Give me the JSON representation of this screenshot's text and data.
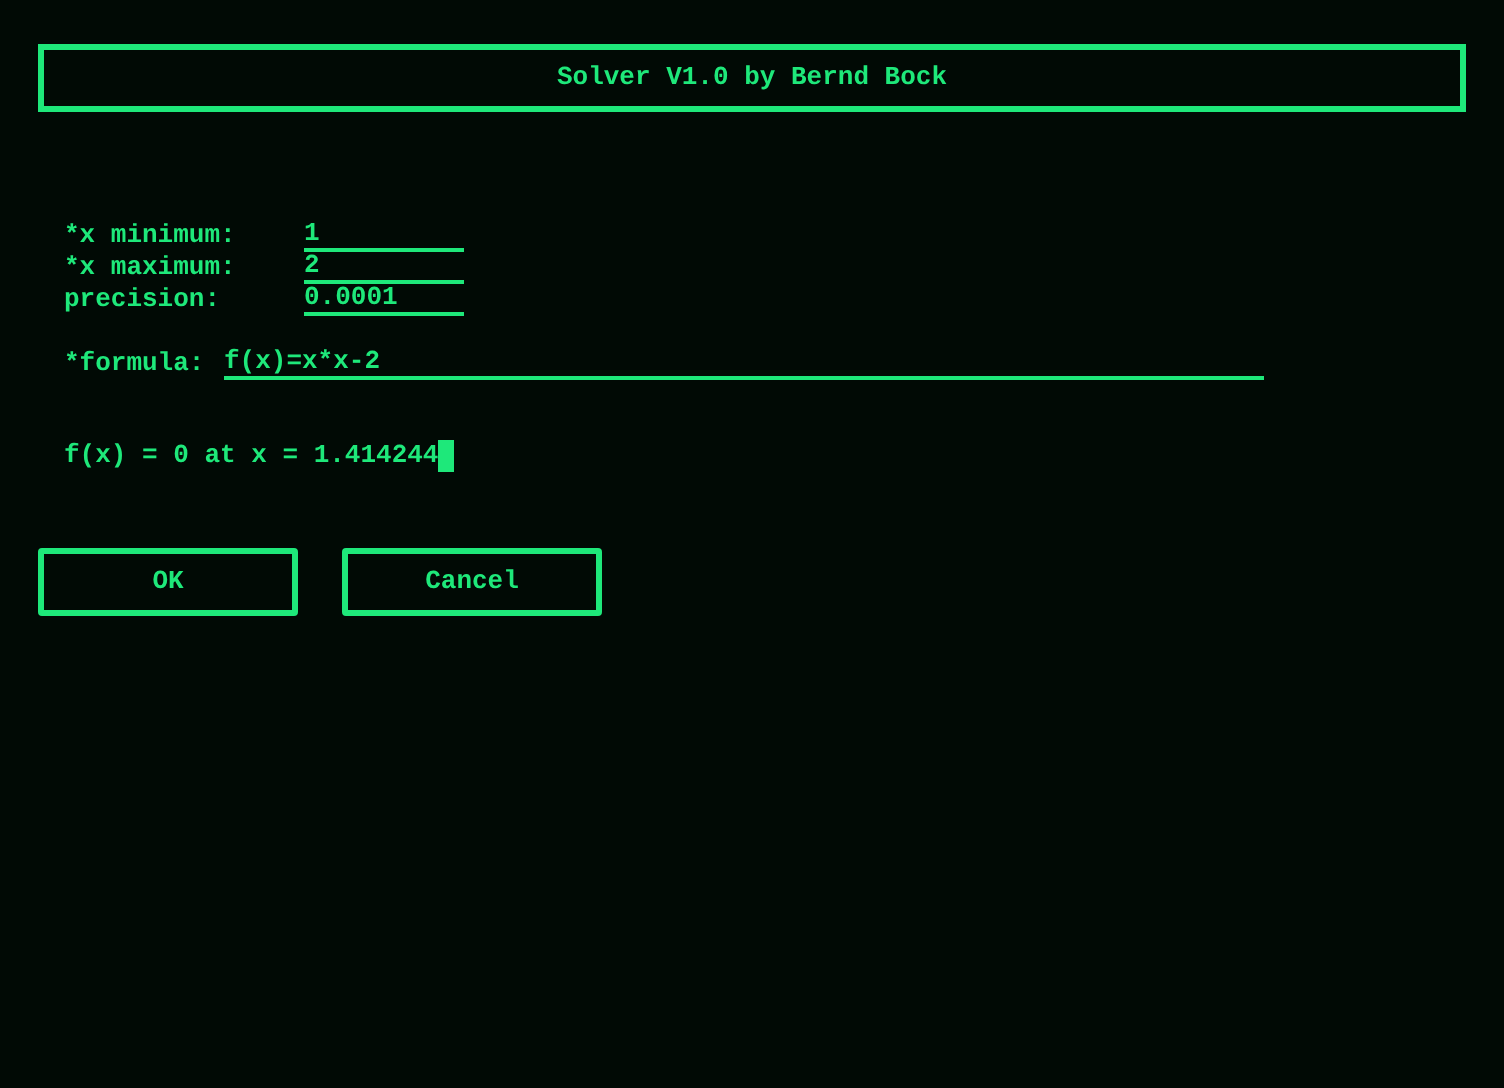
{
  "window": {
    "title": "Solver V1.0 by Bernd Bock"
  },
  "fields": [
    {
      "label": "*x minimum:",
      "value": "1"
    },
    {
      "label": "*x maximum:",
      "value": "2"
    },
    {
      "label": "precision:",
      "value": "0.0001"
    }
  ],
  "formula": {
    "label": "*formula:",
    "value": "f(x)=x*x-2"
  },
  "result": "f(x) = 0 at x = 1.414244",
  "buttons": [
    "OK",
    "Cancel"
  ]
}
